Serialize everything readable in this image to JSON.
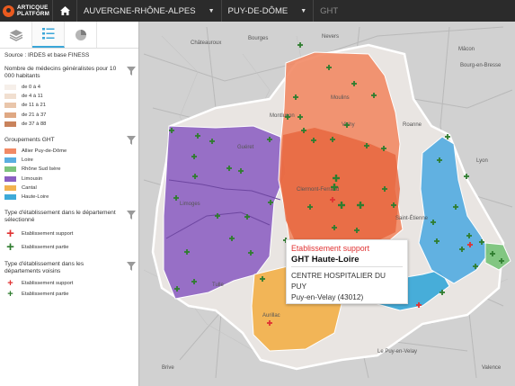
{
  "app": {
    "logo_line1": "ARTICQUE",
    "logo_line2": "PLATFORM"
  },
  "breadcrumb": {
    "region": "AUVERGNE-RHÔNE-ALPES",
    "department": "PUY-DE-DÔME",
    "current": "GHT"
  },
  "sidebar": {
    "tabs": [
      {
        "icon": "layers-icon",
        "active": false
      },
      {
        "icon": "legend-list-icon",
        "active": true
      },
      {
        "icon": "pie-chart-icon",
        "active": false
      }
    ],
    "source": "Source : IRDES et base FINESS",
    "density": {
      "title": "Nombre de médecins généralistes pour 10 000 habitants",
      "items": [
        {
          "label": "de 0 à 4",
          "color": "#f6efe9"
        },
        {
          "label": "de 4 à 11",
          "color": "#f1dfd0"
        },
        {
          "label": "de 11 à 21",
          "color": "#e9c6ab"
        },
        {
          "label": "de 21 à 37",
          "color": "#dfa883"
        },
        {
          "label": "de 37 à 88",
          "color": "#c9835c"
        }
      ]
    },
    "ght": {
      "title": "Groupements GHT",
      "items": [
        {
          "label": "Allier Puy-de-Dôme",
          "color": "#f28a65"
        },
        {
          "label": "Loire",
          "color": "#5aaee0"
        },
        {
          "label": "Rhône Sud Isère",
          "color": "#7cc47c"
        },
        {
          "label": "Limousin",
          "color": "#8b5fc2"
        },
        {
          "label": "Cantal",
          "color": "#f2b24f"
        },
        {
          "label": "Haute-Loire",
          "color": "#3eaad8"
        }
      ]
    },
    "types_dept": {
      "title": "Type d'établissement dans le département sélectionné",
      "items": [
        {
          "label": "Etablissement support",
          "color": "#e03232"
        },
        {
          "label": "Etablissement partie",
          "color": "#2f7d2f"
        }
      ]
    },
    "types_voisins": {
      "title": "Type d'établissement dans les départements voisins",
      "items": [
        {
          "label": "Etablissement support",
          "color": "#e03232"
        },
        {
          "label": "Etablissement partie",
          "color": "#2f7d2f"
        }
      ]
    }
  },
  "map": {
    "places": [
      "Châteauroux",
      "Bourges",
      "Nevers",
      "Moulins",
      "Mâcon",
      "Bourg-en-Bresse",
      "Guéret",
      "Limoges",
      "Tulle",
      "Aurillac",
      "Le Puy-en-Velay",
      "Clermont-Ferrand",
      "Lyon",
      "Valence",
      "Saint-Étienne",
      "Montluçon",
      "Vichy",
      "Roanne",
      "Brive"
    ]
  },
  "tooltip": {
    "header": "Etablissement support",
    "title": "GHT Haute-Loire",
    "name": "CENTRE HOSPITALIER DU PUY",
    "city": "Puy-en-Velay (43012)"
  }
}
